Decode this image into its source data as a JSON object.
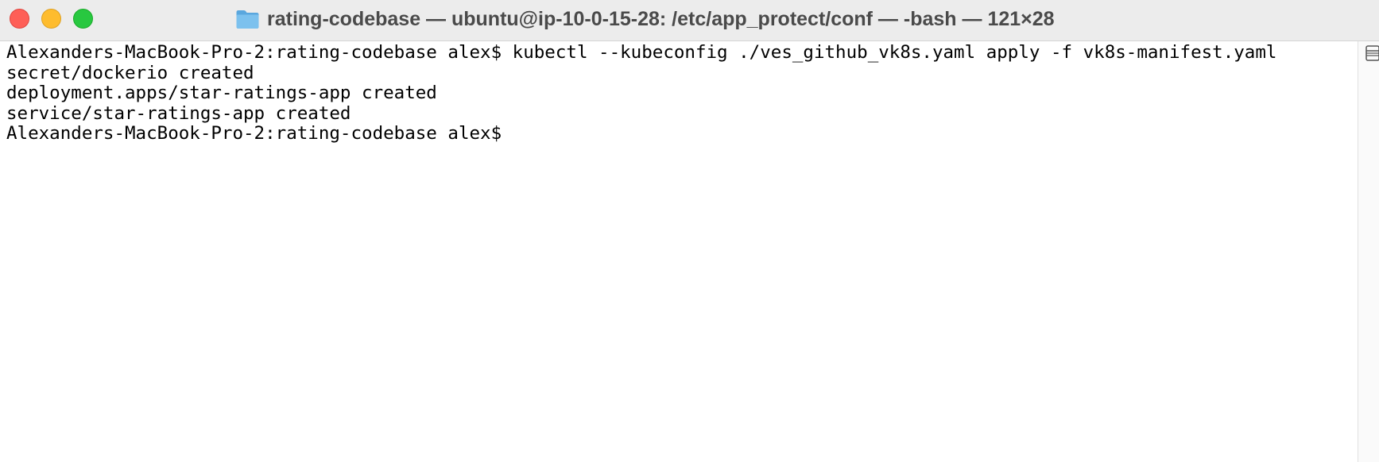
{
  "window": {
    "title": "rating-codebase — ubuntu@ip-10-0-15-28: /etc/app_protect/conf — -bash — 121×28",
    "controls": {
      "close": "close-button",
      "minimize": "minimize-button",
      "zoom": "zoom-button"
    },
    "title_icon": "folder-icon"
  },
  "terminal": {
    "lines": [
      "Alexanders-MacBook-Pro-2:rating-codebase alex$ kubectl --kubeconfig ./ves_github_vk8s.yaml apply -f vk8s-manifest.yaml",
      "secret/dockerio created",
      "deployment.apps/star-ratings-app created",
      "service/star-ratings-app created",
      "Alexanders-MacBook-Pro-2:rating-codebase alex$"
    ]
  },
  "colors": {
    "titlebar": "#ececec",
    "close": "#fe5f57",
    "minimize": "#febc2e",
    "zoom": "#28c840",
    "folder": "#6cb3e6",
    "terminal_bg": "#ffffff",
    "text": "#000000"
  },
  "scrollbar": {
    "icon": "split-pane-icon"
  }
}
